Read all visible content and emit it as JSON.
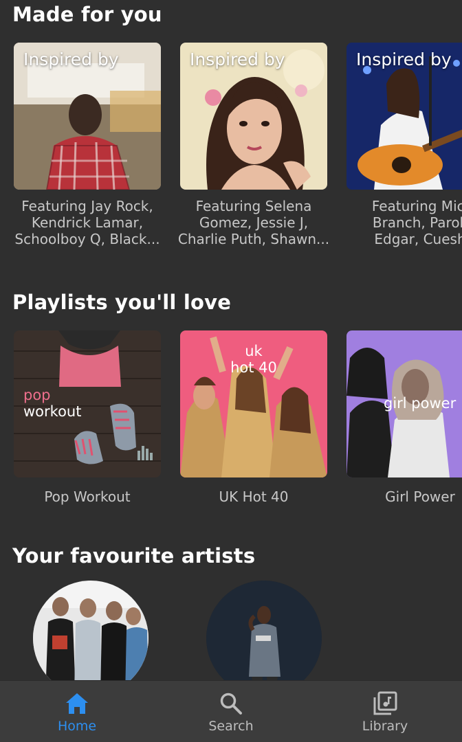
{
  "sections": {
    "made_for_you": {
      "title": "Made for you",
      "cards": [
        {
          "cover_label": "Inspired by",
          "caption": "Featuring Jay Rock,\nKendrick Lamar,\nSchoolboy Q, Black..."
        },
        {
          "cover_label": "Inspired by",
          "caption": "Featuring Selena\nGomez, Jessie J,\nCharlie Puth, Shawn..."
        },
        {
          "cover_label": "Inspired by",
          "caption": "Featuring Micl\nBranch, Parok\nEdgar, Cuesh"
        }
      ]
    },
    "playlists": {
      "title": "Playlists you'll love",
      "cards": [
        {
          "cover_text_1": "pop",
          "cover_text_2": "workout",
          "caption": "Pop Workout"
        },
        {
          "cover_text_1": "uk",
          "cover_text_2": "hot 40",
          "caption": "UK Hot 40"
        },
        {
          "cover_text_1": "girl power",
          "caption": "Girl Power"
        }
      ]
    },
    "artists": {
      "title": "Your favourite artists"
    }
  },
  "nav": {
    "home": "Home",
    "search": "Search",
    "library": "Library"
  },
  "colors": {
    "background": "#2f2f2f",
    "nav_background": "#3c3c3c",
    "accent": "#2d8ff0",
    "caption": "#c8c8c8"
  },
  "icons": {
    "home": "home-icon",
    "search": "search-icon",
    "library": "library-icon"
  }
}
